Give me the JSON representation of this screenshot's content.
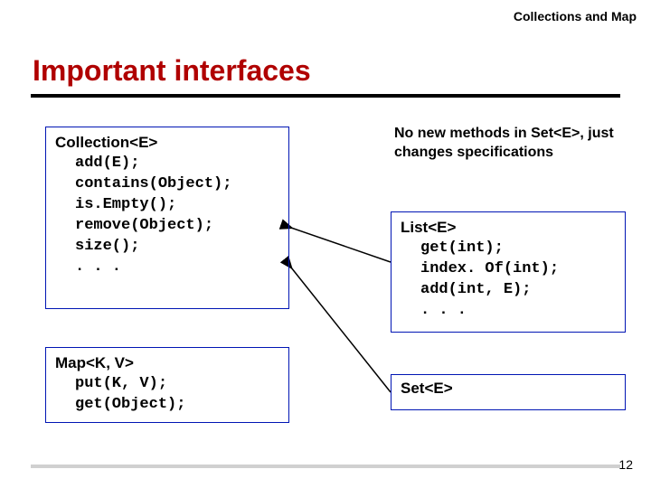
{
  "header": {
    "label": "Collections and Map"
  },
  "title": "Important interfaces",
  "note": "No new methods in Set<E>, just changes specifications",
  "collection": {
    "head": "Collection<E>",
    "body": "add(E);\ncontains(Object);\nis.Empty();\nremove(Object);\nsize();\n. . ."
  },
  "map": {
    "head": "Map<K, V>",
    "body": "put(K, V);\nget(Object);"
  },
  "list": {
    "head": "List<E>",
    "body": "get(int);\nindex. Of(int);\nadd(int, E);\n. . ."
  },
  "set": {
    "head": "Set<E>"
  },
  "page": "12"
}
